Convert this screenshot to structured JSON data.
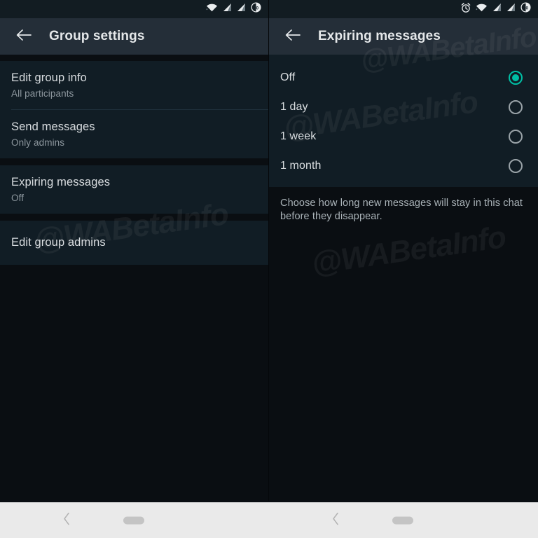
{
  "left_pane": {
    "status_bar": {
      "icons": [
        "wifi-icon",
        "signal-icon",
        "signal-icon",
        "battery-icon"
      ],
      "battery_level": "50"
    },
    "appbar": {
      "back_icon": "arrow-back-icon",
      "title": "Group settings"
    },
    "groups": [
      {
        "items": [
          {
            "title": "Edit group info",
            "subtitle": "All participants"
          },
          {
            "title": "Send messages",
            "subtitle": "Only admins"
          }
        ]
      },
      {
        "items": [
          {
            "title": "Expiring messages",
            "subtitle": "Off"
          }
        ]
      },
      {
        "items": [
          {
            "title": "Edit group admins",
            "subtitle": ""
          }
        ]
      }
    ],
    "watermark": "@WABetaInfo"
  },
  "right_pane": {
    "status_bar": {
      "icons": [
        "alarm-icon",
        "wifi-icon",
        "signal-icon",
        "signal-icon",
        "battery-icon"
      ],
      "battery_level": "50"
    },
    "appbar": {
      "back_icon": "arrow-back-icon",
      "title": "Expiring messages"
    },
    "options": [
      {
        "label": "Off",
        "selected": true
      },
      {
        "label": "1 day",
        "selected": false
      },
      {
        "label": "1 week",
        "selected": false
      },
      {
        "label": "1 month",
        "selected": false
      }
    ],
    "helper_text": "Choose how long new messages will stay in this chat before they disappear.",
    "watermark": "@WABetaInfo"
  },
  "nav_bar": {
    "back_icon": "chevron-back-icon",
    "home_handle": "home-handle"
  },
  "colors": {
    "accent_teal": "#00bfa5",
    "appbar": "#242e38",
    "card": "#111d25",
    "page_bg": "#0a0e12",
    "status_bar": "#121c22",
    "nav_bar": "#eaeaea"
  }
}
